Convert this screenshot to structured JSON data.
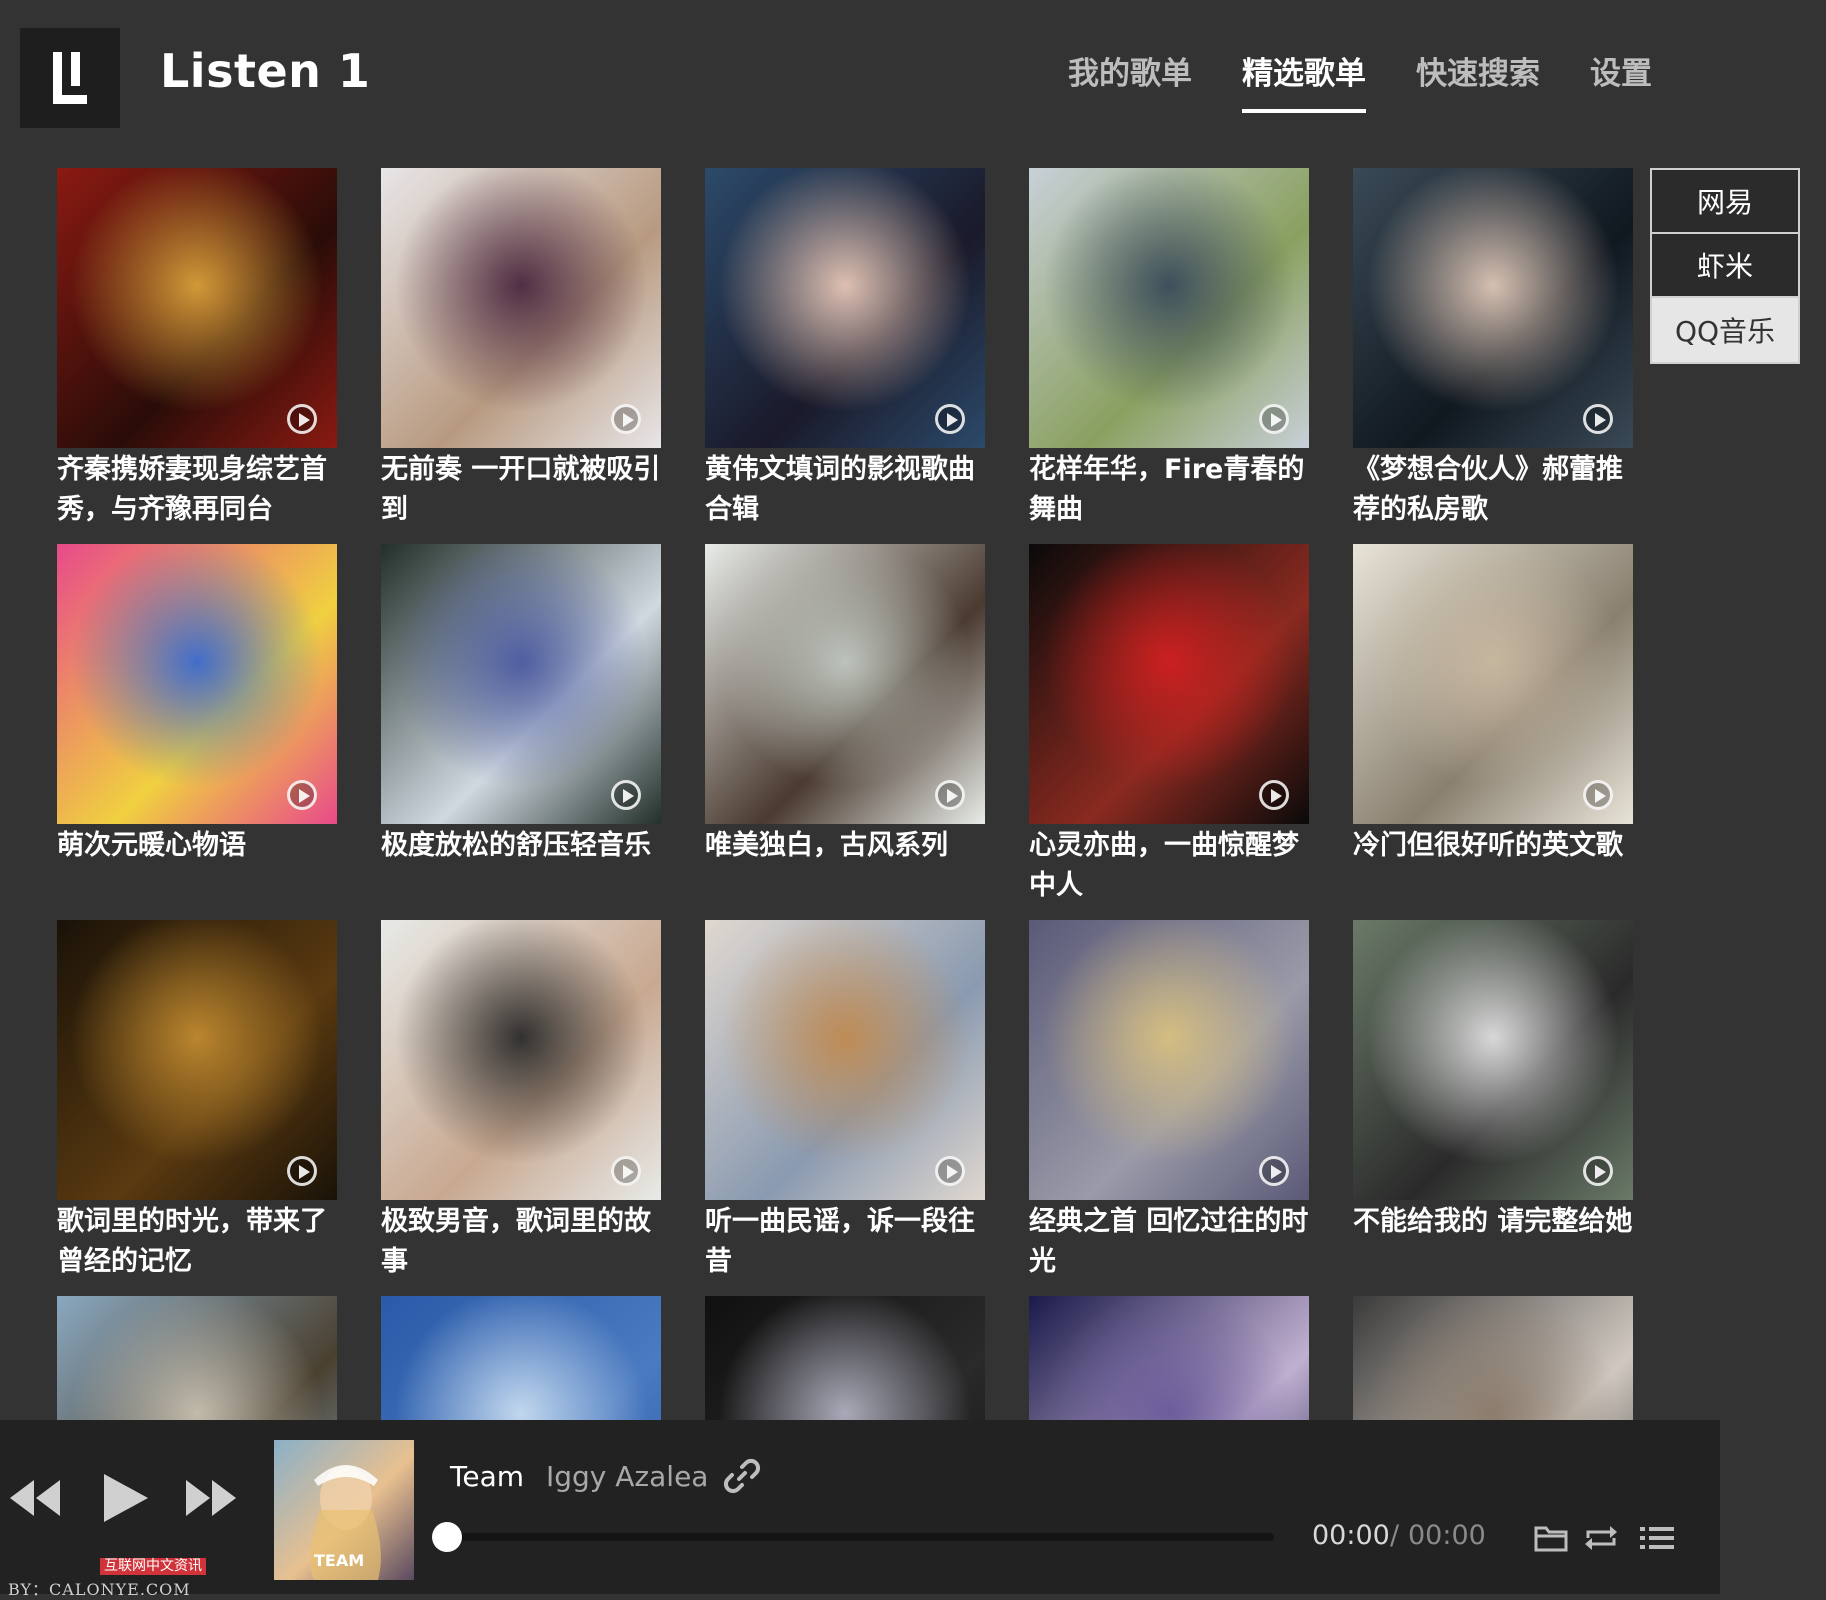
{
  "app": {
    "title": "Listen 1"
  },
  "nav": {
    "items": [
      {
        "label": "我的歌单",
        "active": false
      },
      {
        "label": "精选歌单",
        "active": true
      },
      {
        "label": "快速搜索",
        "active": false
      },
      {
        "label": "设置",
        "active": false
      }
    ]
  },
  "sources": [
    {
      "label": "网易",
      "active": false
    },
    {
      "label": "虾米",
      "active": false
    },
    {
      "label": "QQ音乐",
      "active": true
    }
  ],
  "playlists": [
    {
      "title": "齐秦携娇妻现身综艺首秀，与齐豫再同台",
      "colors": [
        "#8a1a12",
        "#d9a03a",
        "#2a0c08"
      ]
    },
    {
      "title": "无前奏 一开口就被吸引到",
      "colors": [
        "#e8e6e8",
        "#4a2840",
        "#b89a80"
      ]
    },
    {
      "title": "黄伟文填词的影视歌曲合辑",
      "colors": [
        "#2c4a6a",
        "#e8c8b8",
        "#1a1a2a"
      ]
    },
    {
      "title": "花样年华，Fire青春的舞曲",
      "colors": [
        "#c8d0d8",
        "#3a4a5a",
        "#8aa060"
      ]
    },
    {
      "title": "《梦想合伙人》郝蕾推荐的私房歌",
      "colors": [
        "#3a4a56",
        "#e0c8b8",
        "#101820"
      ]
    },
    {
      "title": "萌次元暖心物语",
      "colors": [
        "#e84a8a",
        "#3a6ad0",
        "#f0d040"
      ]
    },
    {
      "title": "极度放松的舒压轻音乐",
      "colors": [
        "#22302a",
        "#4a5aa0",
        "#d0d8e0"
      ]
    },
    {
      "title": "唯美独白，古风系列",
      "colors": [
        "#e8ece8",
        "#c0c8c0",
        "#4a3a30"
      ]
    },
    {
      "title": "心灵亦曲，一曲惊醒梦中人",
      "colors": [
        "#0a0a0a",
        "#d02020",
        "#8a2a20"
      ]
    },
    {
      "title": "冷门但很好听的英文歌",
      "colors": [
        "#e8e4d8",
        "#c8b8a0",
        "#8a8070"
      ]
    },
    {
      "title": "歌词里的时光，带来了曾经的记忆",
      "colors": [
        "#1a1208",
        "#c08a30",
        "#5a3a10"
      ]
    },
    {
      "title": "极致男音，歌词里的故事",
      "colors": [
        "#e8eae8",
        "#2a2a2a",
        "#c8a890"
      ]
    },
    {
      "title": "听一曲民谣，诉一段往昔",
      "colors": [
        "#e0d8d0",
        "#c08a50",
        "#8a9ab0"
      ]
    },
    {
      "title": "经典之首 回忆过往的时光",
      "colors": [
        "#5a5a78",
        "#d8c080",
        "#9a9aa8"
      ]
    },
    {
      "title": "不能给我的 请完整给她",
      "colors": [
        "#6a7a68",
        "#e0e0e0",
        "#2a2a2a"
      ]
    },
    {
      "title": "",
      "colors": [
        "#8aa8c0",
        "#c8c0b0",
        "#4a4030"
      ]
    },
    {
      "title": "",
      "colors": [
        "#2a5aa8",
        "#c8dcf0",
        "#4a7ac0"
      ]
    },
    {
      "title": "",
      "colors": [
        "#101010",
        "#b0b0c0",
        "#2a2a2a"
      ]
    },
    {
      "title": "",
      "colors": [
        "#1a1a4a",
        "#6a5a9a",
        "#c0b0d0"
      ]
    },
    {
      "title": "",
      "colors": [
        "#3a3a3a",
        "#8a7a6a",
        "#d0c8c0"
      ]
    }
  ],
  "player": {
    "song_title": "Team",
    "artist": "Iggy Azalea",
    "cover_text": "TEAM",
    "cover_colors": [
      "#8ab0c8",
      "#e8c090",
      "#5a4a60"
    ],
    "current_time": "00:00",
    "separator": "/",
    "total_time": "00:00",
    "progress": 0
  },
  "watermark": {
    "badge": "互联网中文资讯",
    "by": "BY：CALONYE.COM"
  }
}
